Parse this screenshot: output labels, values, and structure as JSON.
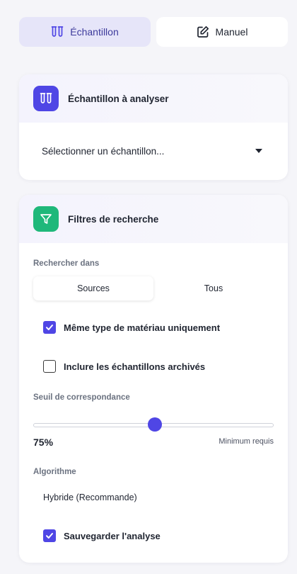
{
  "mode_toggle": {
    "sample_label": "Échantillon",
    "manual_label": "Manuel",
    "active": "sample"
  },
  "sample_card": {
    "title": "Échantillon à analyser",
    "select_placeholder": "Sélectionner un échantillon..."
  },
  "filter_card": {
    "title": "Filtres de recherche",
    "search_in_label": "Rechercher dans",
    "search_in_options": [
      "Sources",
      "Tous"
    ],
    "search_in_selected": "Sources",
    "same_material_label": "Même type de matériau uniquement",
    "same_material_checked": true,
    "include_archived_label": "Inclure les échantillons archivés",
    "include_archived_checked": false,
    "threshold_label": "Seuil de correspondance",
    "threshold_value": 75,
    "threshold_display": "75%",
    "threshold_hint": "Minimum requis",
    "algorithm_label": "Algorithme",
    "algorithm_value": "Hybride (Recommande)",
    "save_label": "Sauvegarder l'analyse",
    "save_checked": true
  },
  "colors": {
    "accent": "#4f46e5",
    "filter_icon_bg": "#1fb87a",
    "active_mode_bg": "#e6e5f9"
  },
  "icons": {
    "sample": "test-tubes-icon",
    "manual": "edit-square-icon",
    "filter": "filter-funnel-icon",
    "dropdown": "caret-down-icon",
    "check": "checkmark-icon"
  }
}
